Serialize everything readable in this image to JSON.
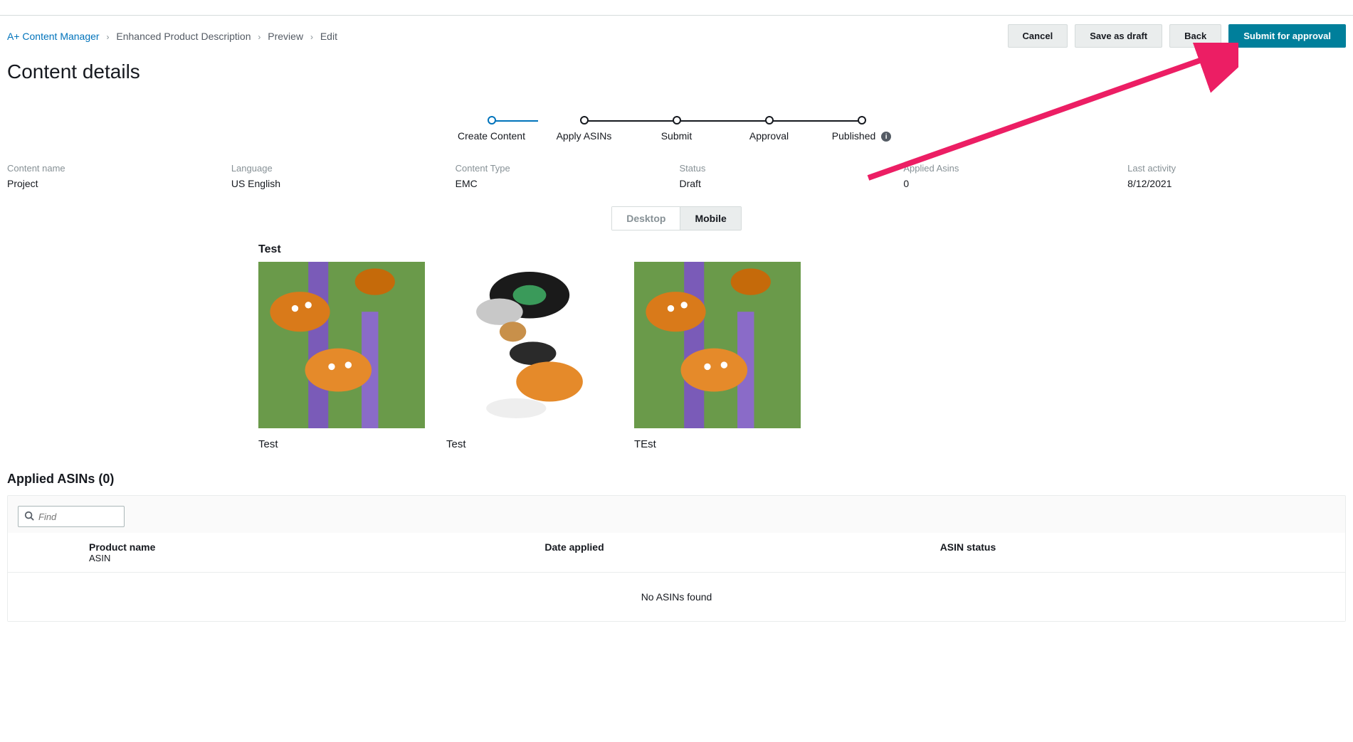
{
  "breadcrumb": {
    "root": "A+ Content Manager",
    "crumb1": "Enhanced Product Description",
    "crumb2": "Preview",
    "crumb3": "Edit"
  },
  "buttons": {
    "cancel": "Cancel",
    "save_draft": "Save as draft",
    "back": "Back",
    "submit": "Submit for approval"
  },
  "page_title": "Content details",
  "stepper": {
    "steps": [
      "Create Content",
      "Apply ASINs",
      "Submit",
      "Approval",
      "Published"
    ],
    "info_icon": "i"
  },
  "meta": {
    "labels": {
      "content_name": "Content name",
      "language": "Language",
      "content_type": "Content Type",
      "status": "Status",
      "applied_asins": "Applied Asins",
      "last_activity": "Last activity"
    },
    "values": {
      "content_name": "Project",
      "language": "US English",
      "content_type": "EMC",
      "status": "Draft",
      "applied_asins": "0",
      "last_activity": "8/12/2021"
    }
  },
  "device_toggle": {
    "desktop": "Desktop",
    "mobile": "Mobile",
    "active": "mobile"
  },
  "preview": {
    "title": "Test",
    "cards": [
      {
        "caption": "Test",
        "image_name": "butterfly-flowers-image"
      },
      {
        "caption": "Test",
        "image_name": "butterfly-collage-image"
      },
      {
        "caption": "TEst",
        "image_name": "butterfly-flowers-image"
      }
    ]
  },
  "applied_asins": {
    "title": "Applied ASINs (0)",
    "search_placeholder": "Find",
    "columns": {
      "product_name": "Product name",
      "product_name_sub": "ASIN",
      "date_applied": "Date applied",
      "asin_status": "ASIN status"
    },
    "empty": "No ASINs found"
  }
}
